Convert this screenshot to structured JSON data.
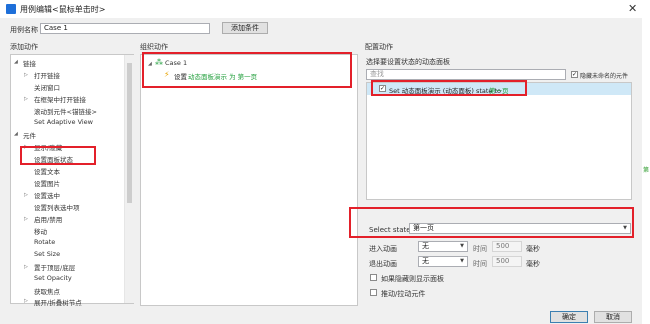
{
  "window": {
    "title": "用例编辑<鼠标单击时>",
    "close": "✕"
  },
  "case_name": {
    "label": "用例名称",
    "value": "Case 1",
    "add_condition": "添加条件"
  },
  "sections": {
    "add_action": "添加动作",
    "organize_action": "组织动作",
    "configure_action": "配置动作"
  },
  "tree": {
    "link_group": "链接",
    "link_items": [
      "打开链接",
      "关闭窗口",
      "在框架中打开链接",
      "滚动到元件<锚链接>",
      "Set Adaptive View"
    ],
    "element_group": "元件",
    "element_items": [
      "显示/隐藏",
      "设置面板状态",
      "设置文本",
      "设置图片",
      "设置选中",
      "设置列表选中项",
      "启用/禁用",
      "移动",
      "Rotate",
      "Set Size",
      "置于顶层/底层",
      "Set Opacity",
      "获取焦点",
      "展开/折叠树节点"
    ]
  },
  "organize": {
    "case_label": "Case 1",
    "action_prefix": "设置",
    "action_target": "动态面板演示 为 第一页"
  },
  "config": {
    "choose_label": "选择要设置状态的动态面板",
    "search_placeholder": "查找",
    "hide_unnamed": "隐藏未命名的元件",
    "hide_unnamed_checked": "✓",
    "panel_item_checked": "✓",
    "panel_item_prefix": "Set 动态面板演示 (动态面板) state to ",
    "panel_item_state": "第一页",
    "select_state_label": "Select state",
    "select_state_value": "第一页",
    "enter_anim_label": "进入动画",
    "enter_anim_value": "无",
    "exit_anim_label": "退出动画",
    "exit_anim_value": "无",
    "time_label": "时间",
    "time_enter": "500",
    "time_exit": "500",
    "ms": "毫秒",
    "show_if_hidden": "如果隐藏则显示面板",
    "push_widgets": "推动/拉动元件"
  },
  "buttons": {
    "ok": "确定",
    "cancel": "取消"
  },
  "side_mark": "第",
  "icons": {
    "app": "app-icon",
    "lightning": "lightning-icon",
    "case": "case-icon"
  },
  "colors": {
    "highlight": "#e3202a",
    "selected_row": "#cfe8f7",
    "green_text": "#1f9e3a"
  }
}
